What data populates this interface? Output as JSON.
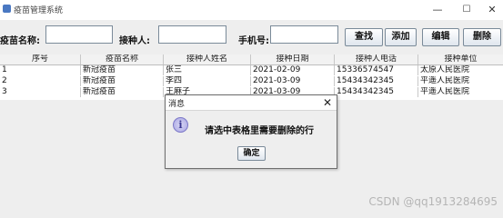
{
  "window": {
    "title": "疫苗管理系统",
    "minimize": "—",
    "maximize": "☐",
    "close": "✕"
  },
  "form": {
    "vaccine_label": "疫苗名称:",
    "vaccine_value": "",
    "person_label": "接种人:",
    "person_value": "",
    "phone_label": "手机号:",
    "phone_value": ""
  },
  "buttons": {
    "search": "查找",
    "add": "添加",
    "edit": "编辑",
    "delete": "删除"
  },
  "table": {
    "headers": [
      "序号",
      "疫苗名称",
      "接种人姓名",
      "接种日期",
      "接种人电话",
      "接种单位"
    ],
    "rows": [
      [
        "1",
        "新冠疫苗",
        "张三",
        "2021-02-09",
        "15336574547",
        "太原人民医院"
      ],
      [
        "2",
        "新冠疫苗",
        "李四",
        "2021-03-09",
        "15434342345",
        "平遥人民医院"
      ],
      [
        "3",
        "新冠疫苗",
        "王麻子",
        "2021-03-09",
        "15434342345",
        "平遥人民医院"
      ]
    ]
  },
  "dialog": {
    "title": "消息",
    "close": "✕",
    "message": "请选中表格里需要删除的行",
    "ok": "确定"
  },
  "watermark": "CSDN @qq1913284695"
}
